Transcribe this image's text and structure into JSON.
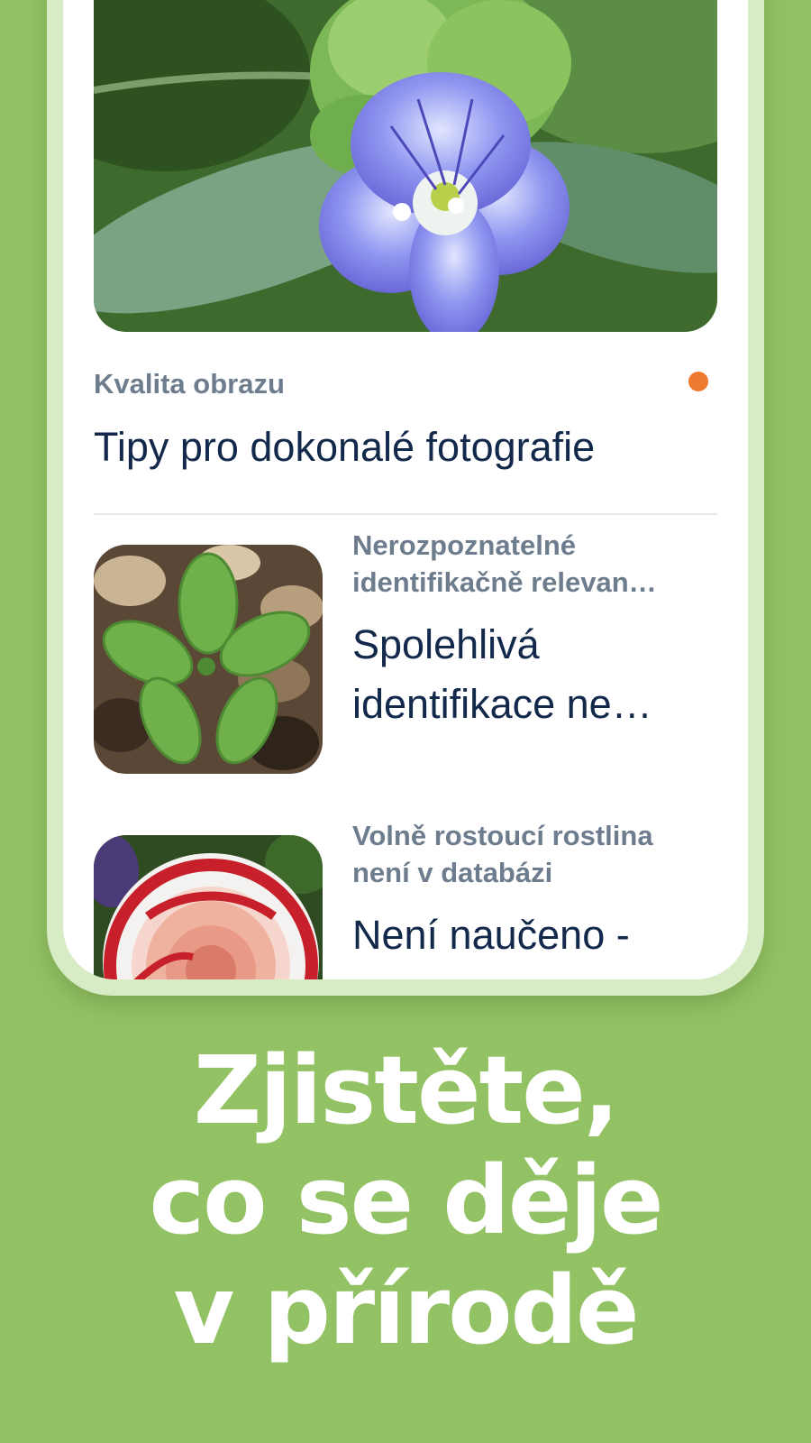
{
  "featured": {
    "category": "Kvalita obrazu",
    "title": "Tipy pro dokonalé fotografie",
    "image_icon": "blue-flower-photo",
    "unread_color": "#ee7a2f"
  },
  "articles": [
    {
      "category_line1": "Nerozpoznatelné",
      "category_line2": "identifikačně relevan…",
      "title_line1": "Spolehlivá",
      "title_line2": "identifikace ne…",
      "image_icon": "leaf-photo"
    },
    {
      "category_line1": "Volně rostoucí rostlina",
      "category_line2": "není v databázi",
      "title_line1": "Není naučeno -",
      "image_icon": "rose-photo"
    }
  ],
  "tagline": {
    "line1": "Zjistěte,",
    "line2": "co se děje",
    "line3": "v přírodě"
  },
  "colors": {
    "background": "#93c264",
    "title_text": "#13294b",
    "category_text": "#6e7d8e"
  }
}
